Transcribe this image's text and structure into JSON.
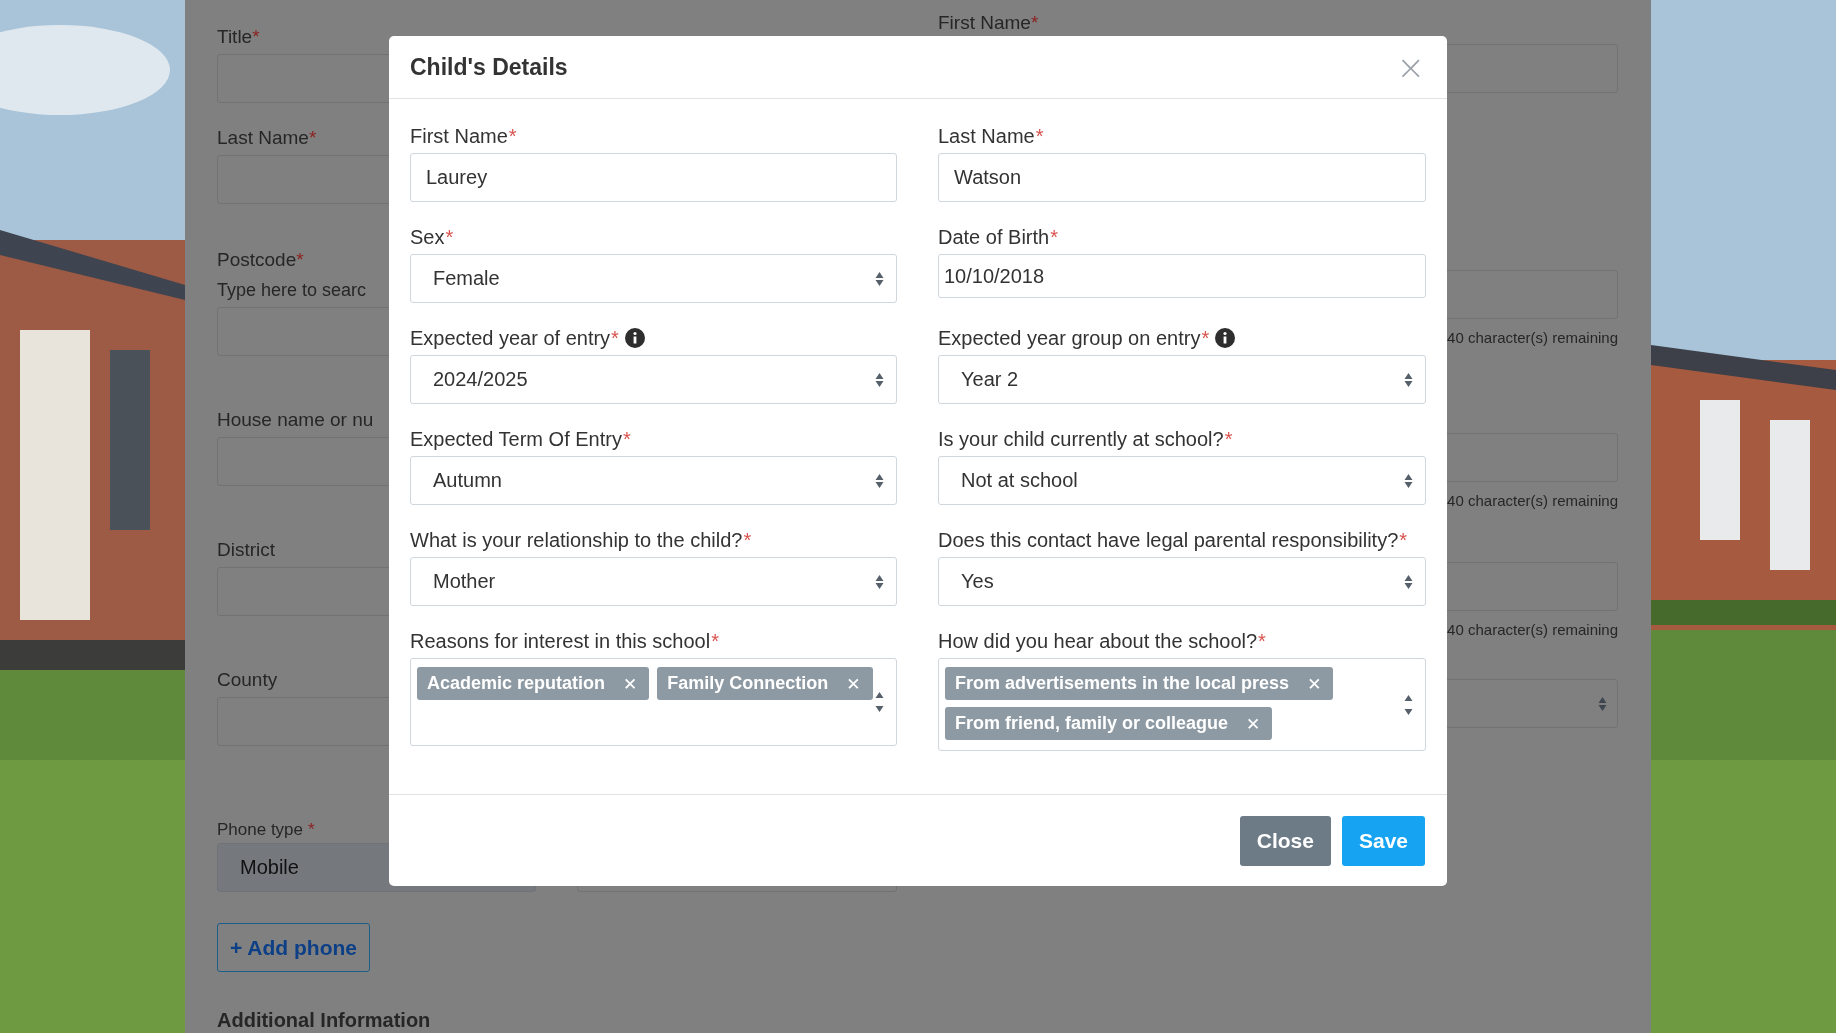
{
  "background_form": {
    "left_fields": [
      {
        "label": "Title",
        "mark": "*"
      },
      {
        "label": "Last Name",
        "mark": "*"
      },
      {
        "label": "Postcode",
        "mark": "*",
        "hint": "Type here to searc"
      },
      {
        "label": "House name or nu"
      },
      {
        "label": "District"
      },
      {
        "label": "County"
      }
    ],
    "right_fields": [
      {
        "label": "First Name",
        "mark": "*",
        "kind": "text"
      },
      {
        "kind": "text",
        "counter": "40 character(s) remaining"
      },
      {
        "kind": "text",
        "counter": "40 character(s) remaining"
      },
      {
        "kind": "text",
        "counter": "40 character(s) remaining"
      },
      {
        "kind": "select"
      }
    ],
    "phone": {
      "label": "Phone type",
      "mark": "*",
      "value": "Mobile"
    },
    "add_phone_button": "+ Add phone",
    "section_heading": "Additional Information"
  },
  "modal": {
    "title": "Child's Details",
    "close_icon": "×",
    "fields": [
      {
        "label": "First Name",
        "mark": "*",
        "kind": "text",
        "value": "Laurey"
      },
      {
        "label": "Last Name",
        "mark": "*",
        "kind": "text",
        "value": "Watson"
      },
      {
        "label": "Sex",
        "mark": "*",
        "kind": "select",
        "value": "Female"
      },
      {
        "label": "Date of Birth",
        "mark": "*",
        "kind": "date",
        "value": "10/10/2018"
      },
      {
        "label": "Expected year of entry",
        "mark": "*",
        "info": true,
        "kind": "select",
        "value": "2024/2025"
      },
      {
        "label": "Expected year group on entry",
        "mark": "*",
        "info": true,
        "kind": "select",
        "value": "Year 2"
      },
      {
        "label": "Expected Term Of Entry",
        "mark": "*",
        "kind": "select",
        "value": "Autumn"
      },
      {
        "label": "Is your child currently at school?",
        "mark": "*",
        "kind": "select",
        "value": "Not at school"
      },
      {
        "label": "What is your relationship to the child?",
        "mark": "*",
        "kind": "select",
        "value": "Mother"
      },
      {
        "label": "Does this contact have legal parental responsibility?",
        "mark": "*",
        "kind": "select",
        "value": "Yes"
      },
      {
        "label": "Reasons for interest in this school",
        "mark": "*",
        "kind": "multiselect",
        "tags": [
          "Academic reputation",
          "Family Connection"
        ],
        "remove_icon": "✕"
      },
      {
        "label": "How did you hear about the school?",
        "mark": "*",
        "kind": "multiselect",
        "tags": [
          "From advertisements in the local press",
          "From friend, family or colleague"
        ],
        "remove_icon": "✕"
      }
    ],
    "buttons": [
      {
        "label": "Close",
        "kind": "secondary"
      },
      {
        "label": "Save",
        "kind": "primary"
      }
    ]
  }
}
